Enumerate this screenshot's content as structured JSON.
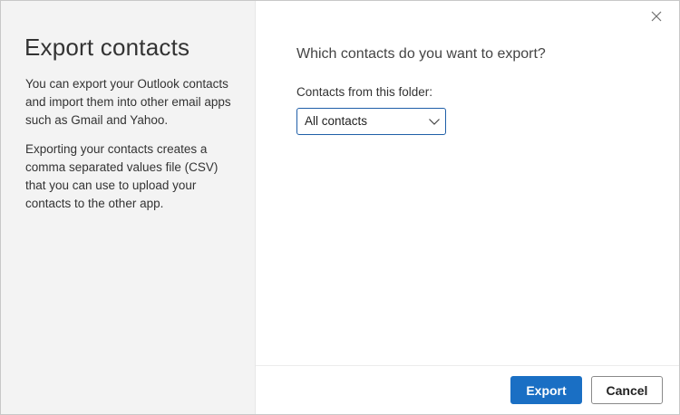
{
  "sidebar": {
    "title": "Export contacts",
    "paragraph_1": "You can export your Outlook contacts and import them into other email apps such as Gmail and Yahoo.",
    "paragraph_2": "Exporting your contacts creates a comma separated values file (CSV) that you can use to upload your contacts to the other app."
  },
  "main": {
    "question": "Which contacts do you want to export?",
    "folder_label": "Contacts from this folder:",
    "folder_select": {
      "value": "All contacts"
    }
  },
  "footer": {
    "export_label": "Export",
    "cancel_label": "Cancel"
  },
  "icons": {
    "close": "close-icon",
    "dropdown": "chevron-down-icon"
  },
  "colors": {
    "primary": "#1a6fc4",
    "sidebar_bg": "#f3f3f3",
    "select_border": "#1f5fa8"
  }
}
